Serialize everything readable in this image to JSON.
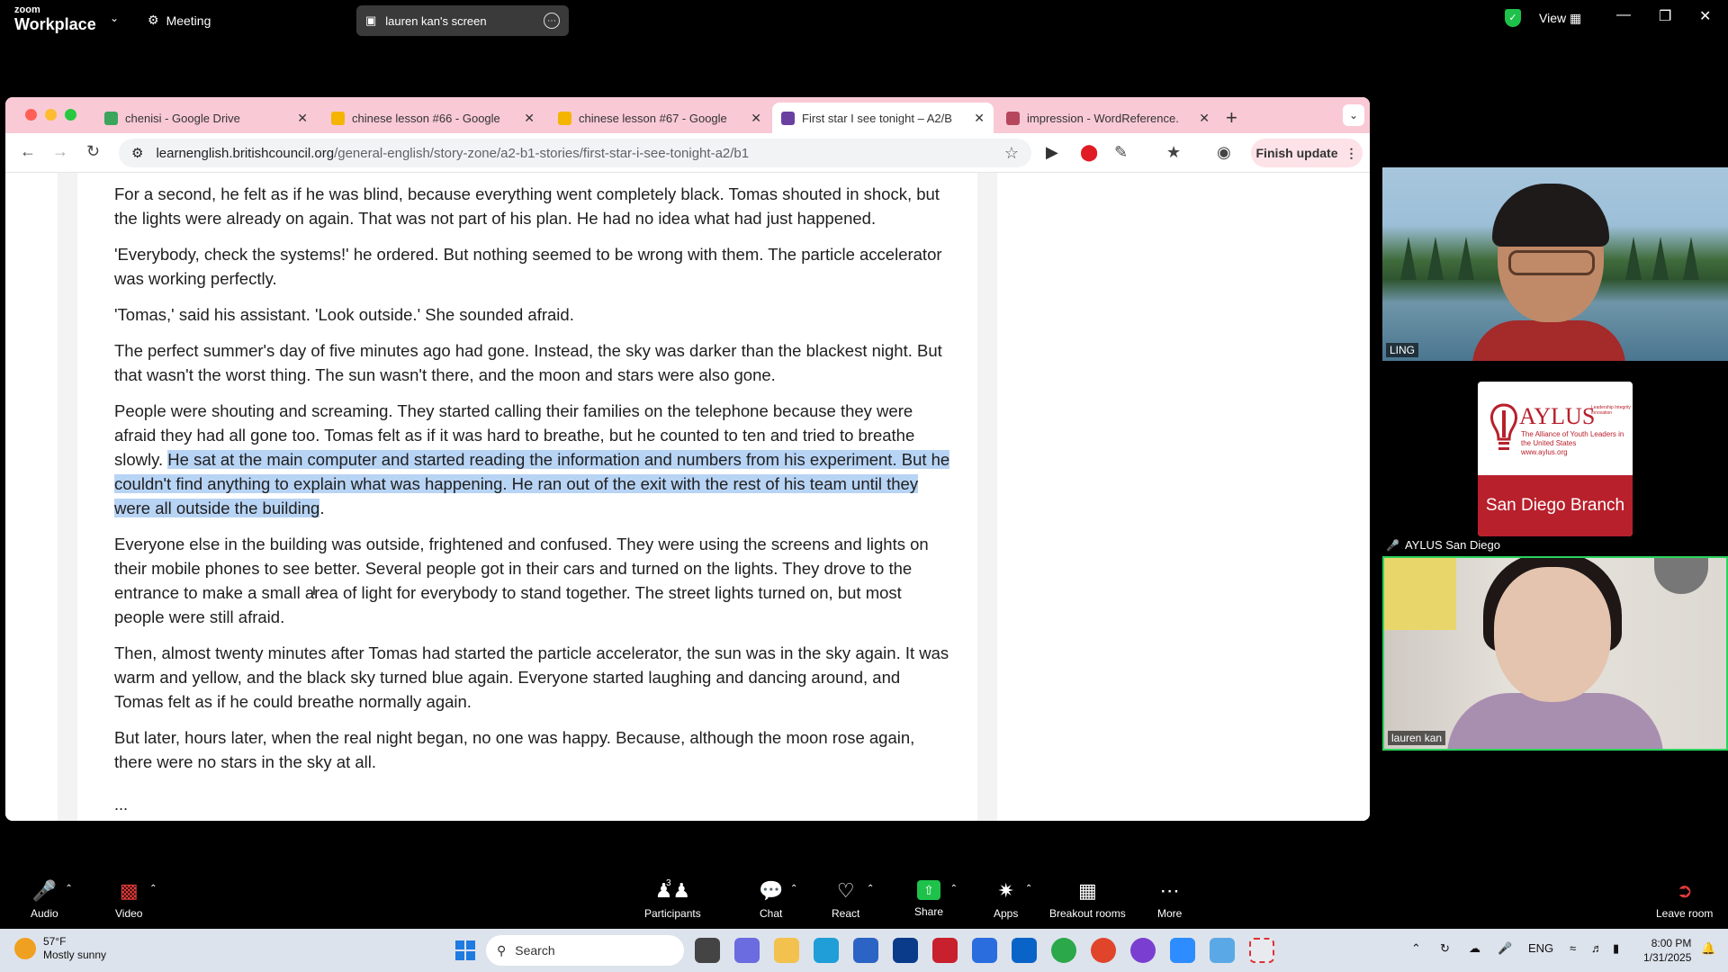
{
  "zoom": {
    "brand_small": "zoom",
    "brand_big": "Workplace",
    "meeting_label": "Meeting",
    "share_title": "lauren kan's screen",
    "view_label": "View"
  },
  "browser": {
    "tabs": [
      {
        "title": "chenisi - Google Drive",
        "color": "#3ba55c"
      },
      {
        "title": "chinese lesson #66 - Google",
        "color": "#f4b400"
      },
      {
        "title": "chinese lesson #67 - Google",
        "color": "#f4b400"
      },
      {
        "title": "First star I see tonight – A2/B",
        "color": "#6b3fa0"
      },
      {
        "title": "impression - WordReference.",
        "color": "#b6465c"
      }
    ],
    "url_host": "learnenglish.britishcouncil.org",
    "url_path": "/general-english/story-zone/a2-b1-stories/first-star-i-see-tonight-a2/b1",
    "finish_update": "Finish update"
  },
  "article": {
    "p1": "For a second, he felt as if he was blind, because everything went completely black. Tomas shouted in shock, but the lights were already on again. That was not part of his plan. He had no idea what had just happened.",
    "p2": "'Everybody, check the systems!' he ordered. But nothing seemed to be wrong with them. The particle accelerator was working perfectly.",
    "p3": "'Tomas,' said his assistant. 'Look outside.' She sounded afraid.",
    "p4": "The perfect summer's day of five minutes ago had gone. Instead, the sky was darker than the blackest night. But that wasn't the worst thing. The sun wasn't there, and the moon and stars were also gone.",
    "p5_start": "People were shouting and screaming. They started calling their families on the telephone because they were afraid they had all gone too. Tomas felt as if it was hard to breathe, but he counted to ten and tried to breathe slowly. ",
    "p5_highlight": "He sat at the main computer and started reading the information and numbers from his experiment. But he couldn't find anything to explain what was happening. He ran out of the exit with the rest of his team until they were all outside the building",
    "p5_end": ".",
    "p6": "Everyone else in the building was outside, frightened and confused. They were using the screens and lights on their mobile phones to see better. Several people got in their cars and turned on the lights. They drove to the entrance to make a small area of light for everybody to stand together. The street lights turned on, but most people were still afraid.",
    "p7": "Then, almost twenty minutes after Tomas had started the particle accelerator, the sun was in the sky again. It was warm and yellow, and the black sky turned blue again. Everyone started laughing and dancing around, and Tomas felt as if he could breathe normally again.",
    "p8": "But later, hours later, when the real night began, no one was happy. Because, although the moon rose again, there were no stars in the sky at all.",
    "ellipsis": "..."
  },
  "participants": {
    "ling": "LING",
    "aylus_label": "AYLUS San Diego",
    "aylus_logo": "AYLUS",
    "aylus_tagline": "The Alliance of Youth Leaders in the United States",
    "aylus_site": "www.aylus.org",
    "aylus_values": "Leadership Integrity Innovation",
    "aylus_branch": "San Diego Branch",
    "lauren": "lauren kan"
  },
  "controls": {
    "audio": "Audio",
    "video": "Video",
    "participants": "Participants",
    "participants_count": "3",
    "chat": "Chat",
    "react": "React",
    "share": "Share",
    "apps": "Apps",
    "breakout": "Breakout rooms",
    "more": "More",
    "leave": "Leave room"
  },
  "taskbar": {
    "temp": "57°F",
    "weather": "Mostly sunny",
    "search": "Search",
    "lang": "ENG",
    "time": "8:00 PM",
    "date": "1/31/2025"
  }
}
